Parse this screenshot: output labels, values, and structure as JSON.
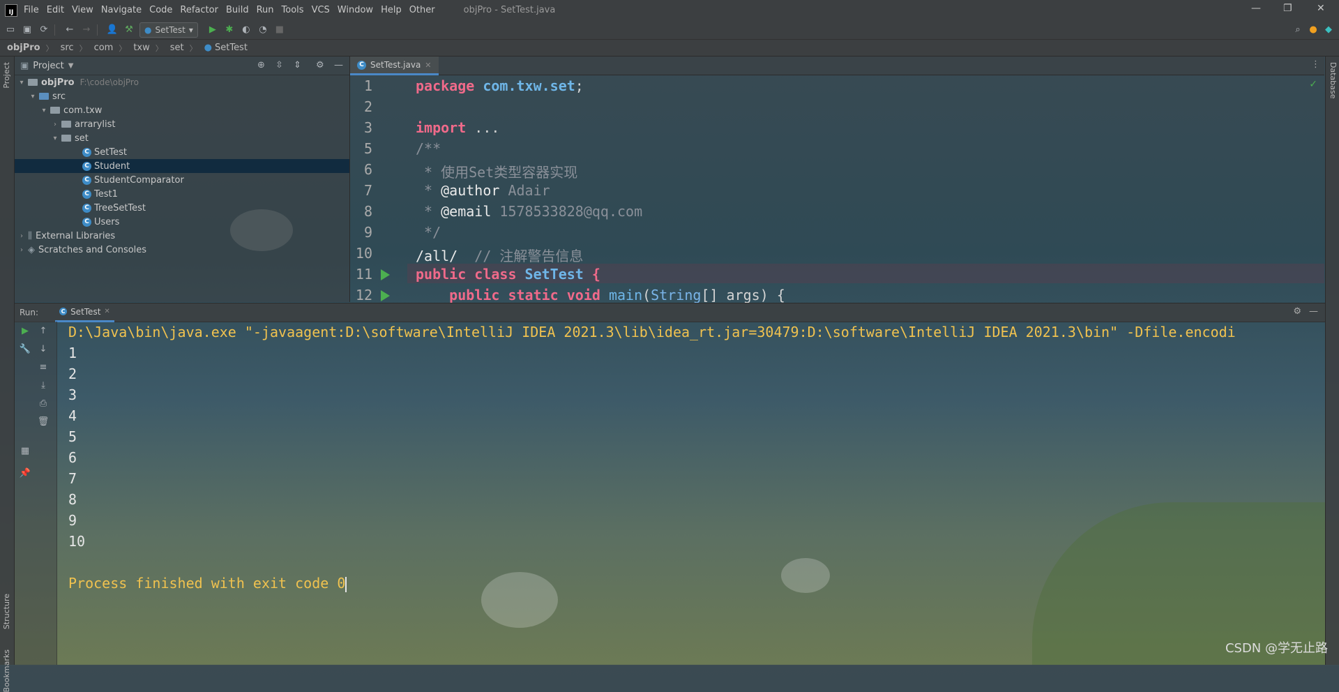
{
  "menubar": {
    "logo": "IJ",
    "items": [
      "File",
      "Edit",
      "View",
      "Navigate",
      "Code",
      "Refactor",
      "Build",
      "Run",
      "Tools",
      "VCS",
      "Window",
      "Help",
      "Other"
    ],
    "window_title": "objPro - SetTest.java"
  },
  "toolbar": {
    "run_config": "SetTest"
  },
  "breadcrumb": [
    "objPro",
    "src",
    "com",
    "txw",
    "set",
    "SetTest"
  ],
  "left_stripe": {
    "project": "Project",
    "structure": "Structure",
    "bookmarks": "Bookmarks"
  },
  "right_stripe": {
    "database": "Database"
  },
  "project": {
    "title": "Project",
    "root": {
      "name": "objPro",
      "path": "F:\\code\\objPro"
    },
    "tree": [
      {
        "label": "src"
      },
      {
        "label": "com.txw"
      },
      {
        "label": "arrarylist"
      },
      {
        "label": "set"
      },
      {
        "label": "SetTest"
      },
      {
        "label": "Student"
      },
      {
        "label": "StudentComparator"
      },
      {
        "label": "Test1"
      },
      {
        "label": "TreeSetTest"
      },
      {
        "label": "Users"
      },
      {
        "label": "External Libraries"
      },
      {
        "label": "Scratches and Consoles"
      }
    ]
  },
  "editor": {
    "tab": "SetTest.java",
    "line_numbers": [
      "1",
      "2",
      "3",
      "5",
      "6",
      "7",
      "8",
      "9",
      "10",
      "11",
      "12"
    ],
    "code": {
      "l1_kw": "package",
      "l1_pkg": "com.txw.set",
      "l1_end": ";",
      "l3_kw": "import",
      "l3_rest": " ...",
      "l5": "/**",
      "l6": " * 使用Set类型容器实现",
      "l7_star": " * ",
      "l7_tag": "@author",
      "l7_val": " Adair",
      "l8_star": " * ",
      "l8_tag": "@email",
      "l8_val": " 1578533828@qq.com",
      "l9": " */",
      "l10_ann": "/all/",
      "l10_cm": "  // 注解警告信息",
      "l11_kw": "public class",
      "l11_name": " SetTest",
      "l11_brace": " {",
      "l12_kw": "    public static void",
      "l12_fn": " main",
      "l12_p1": "(",
      "l12_type": "String",
      "l12_rest": "[] args) {"
    }
  },
  "run": {
    "label": "Run:",
    "tab": "SetTest",
    "command": "D:\\Java\\bin\\java.exe \"-javaagent:D:\\software\\IntelliJ IDEA 2021.3\\lib\\idea_rt.jar=30479:D:\\software\\IntelliJ IDEA 2021.3\\bin\" -Dfile.encodi",
    "output": [
      "1",
      "2",
      "3",
      "4",
      "5",
      "6",
      "7",
      "8",
      "9",
      "10"
    ],
    "finished": "Process finished with exit code 0"
  },
  "watermark": "CSDN @学无止路",
  "colors": {
    "keyword": "#f06a8a",
    "package": "#6fb6e8",
    "console_text": "#f0c24f",
    "selection": "#0d293e",
    "tab_underline": "#4a88c7",
    "run_green": "#4caf50"
  }
}
